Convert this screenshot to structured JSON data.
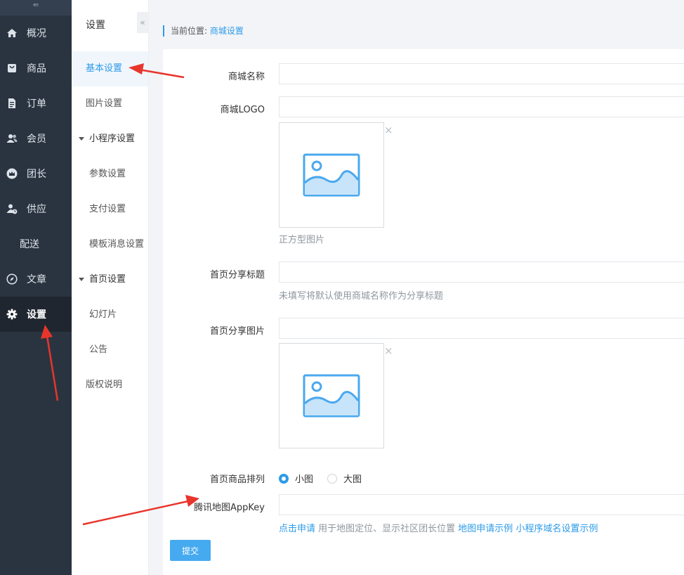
{
  "left_nav": {
    "toggle_glyph": "⇚",
    "items": [
      {
        "label": "概况",
        "icon": "home-icon"
      },
      {
        "label": "商品",
        "icon": "bag-icon"
      },
      {
        "label": "订单",
        "icon": "document-icon"
      },
      {
        "label": "会员",
        "icon": "users-icon"
      },
      {
        "label": "团长",
        "icon": "crown-icon"
      },
      {
        "label": "供应",
        "icon": "supplier-icon"
      },
      {
        "label": "配送",
        "icon": ""
      },
      {
        "label": "文章",
        "icon": "compass-icon"
      },
      {
        "label": "设置",
        "icon": "gear-icon",
        "active": true
      }
    ]
  },
  "sub_nav": {
    "title": "设置",
    "collapse_glyph": "«",
    "basic": "基本设置",
    "image": "图片设置",
    "miniapp_group": "小程序设置",
    "params": "参数设置",
    "payment": "支付设置",
    "template_msg": "模板消息设置",
    "home_group": "首页设置",
    "slides": "幻灯片",
    "notice": "公告",
    "copyright": "版权说明"
  },
  "breadcrumb": {
    "prefix": "当前位置:",
    "current": "商城设置"
  },
  "form": {
    "shop_name_label": "商城名称",
    "shop_name_value": "",
    "logo_label": "商城LOGO",
    "logo_value": "",
    "logo_help": "正方型图片",
    "share_title_label": "首页分享标题",
    "share_title_value": "",
    "share_title_help": "未填写将默认使用商城名称作为分享标题",
    "share_image_label": "首页分享图片",
    "share_image_value": "",
    "sort_label": "首页商品排列",
    "sort_options": [
      "小图",
      "大图"
    ],
    "sort_selected": "小图",
    "map_key_label": "腾讯地图AppKey",
    "map_key_value": "",
    "map_help_link1": "点击申请",
    "map_help_text": " 用于地图定位、显示社区团长位置 ",
    "map_help_link2": "地图申请示例",
    "map_help_link3": "小程序域名设置示例",
    "remove_glyph": "×",
    "submit_label": "提交"
  },
  "colors": {
    "accent": "#2d9be8",
    "annotation_arrow": "#e8352c",
    "nav_bg": "#2a3440"
  }
}
